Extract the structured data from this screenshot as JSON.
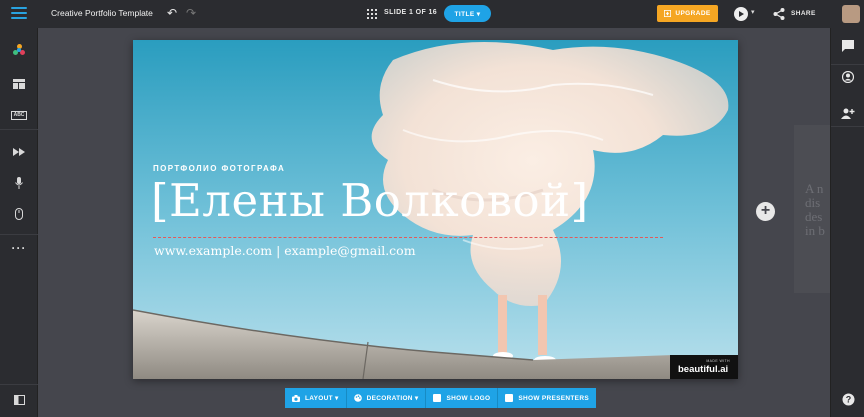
{
  "topbar": {
    "doc_title": "Creative Portfolio Template",
    "slide_counter": "SLIDE 1 OF 16",
    "layout_pill": "TITLE ▾",
    "upgrade_label": "UPGRADE",
    "share_label": "SHARE",
    "accent": "#1fa3e6",
    "upgrade_color": "#f5a623"
  },
  "left_sidebar": {
    "items": [
      "menu-icon",
      "theme-palette-icon",
      "layout-icon",
      "text-style-icon",
      "animation-icon",
      "microphone-icon",
      "mouse-icon",
      "more-icon",
      "slide-panel-icon"
    ]
  },
  "right_sidebar": {
    "items": [
      "comments-icon",
      "account-icon",
      "add-collaborator-icon",
      "help-icon"
    ]
  },
  "slide": {
    "kicker": "ПОРТФОЛИО ФОТОГРАФА",
    "headline": "[Елены Волковой]",
    "contact": "www.example.com | example@gmail.com",
    "badge_made_with": "MADE WITH",
    "badge_brand": "beautiful.ai"
  },
  "next_slide_preview": {
    "text": "A n\ndis\ndes\nin b"
  },
  "bottom_toolbar": {
    "layout": "LAYOUT ▾",
    "decoration": "DECORATION ▾",
    "show_logo": "SHOW LOGO",
    "show_presenters": "SHOW PRESENTERS"
  }
}
